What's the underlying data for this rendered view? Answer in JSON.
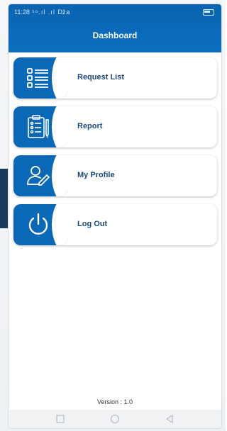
{
  "status_bar": {
    "time": "11:28",
    "signal": "⁵⁶.ıl .ıl ǅa"
  },
  "header": {
    "title": "Dashboard"
  },
  "menu": {
    "items": [
      {
        "label": "Request List",
        "icon": "list-icon"
      },
      {
        "label": "Report",
        "icon": "clipboard-icon"
      },
      {
        "label": "My Profile",
        "icon": "user-edit-icon"
      },
      {
        "label": "Log Out",
        "icon": "power-icon"
      }
    ]
  },
  "footer": {
    "version": "Version : 1.0"
  },
  "colors": {
    "primary": "#0a68b6",
    "label": "#1c4a7a"
  }
}
